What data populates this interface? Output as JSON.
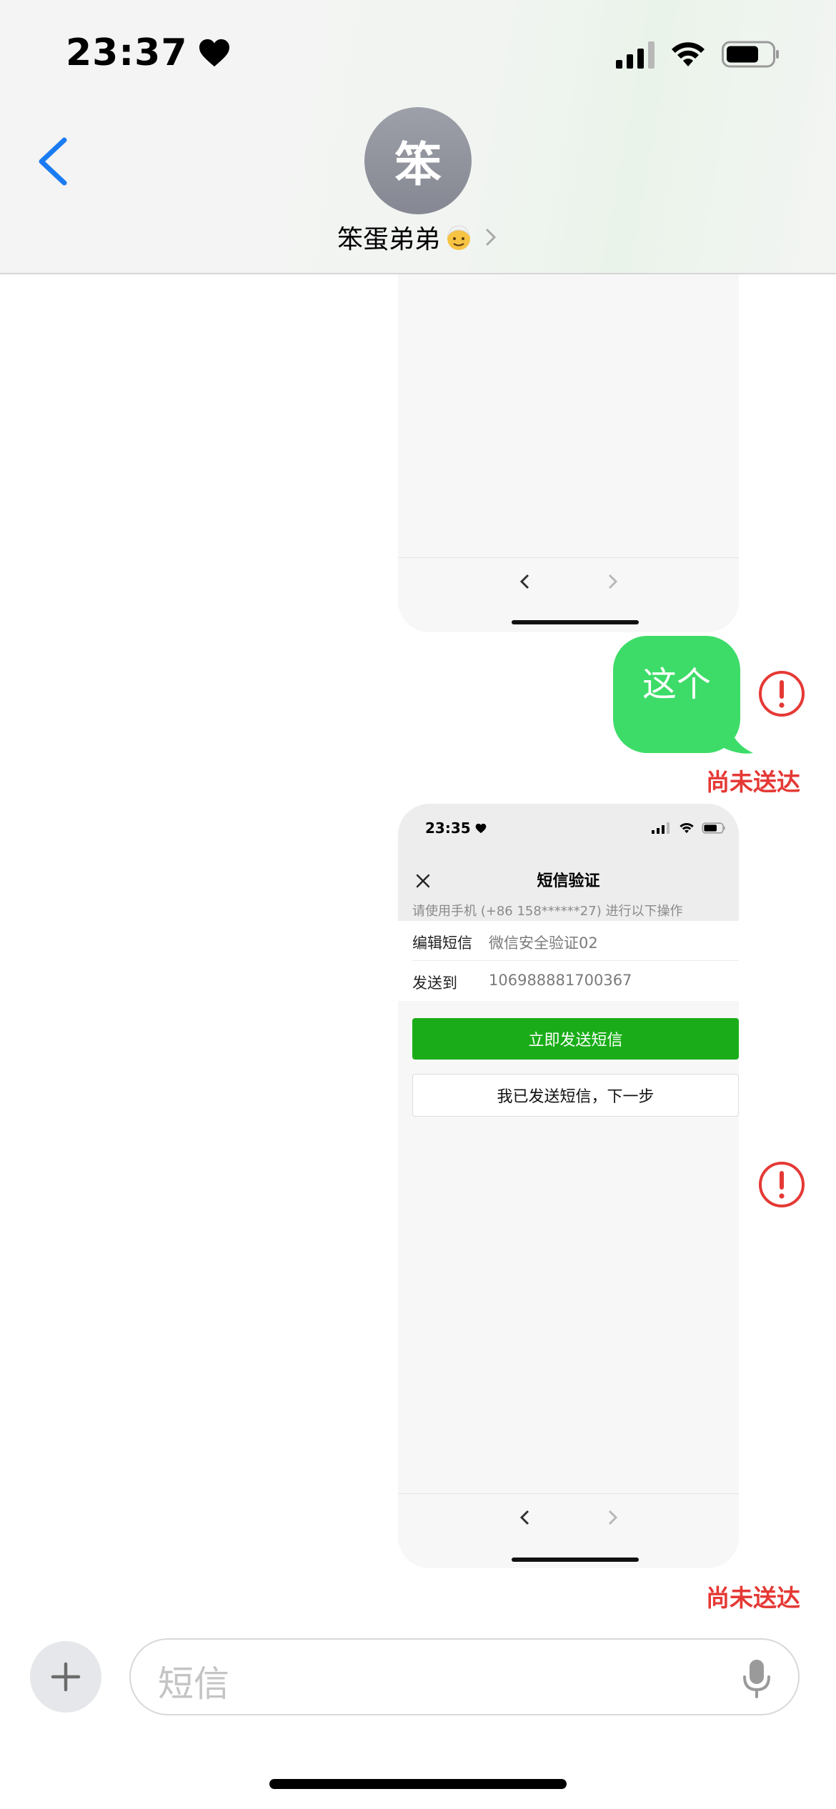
{
  "status_bar": {
    "time": "23:37"
  },
  "header": {
    "avatar_initial": "笨",
    "contact_name": "笨蛋弟弟"
  },
  "messages": [
    {
      "type": "text",
      "text": "这个",
      "status": "尚未送达"
    },
    {
      "type": "screenshot",
      "status": "尚未送达"
    }
  ],
  "embedded_screenshot": {
    "time": "23:35",
    "title": "短信验证",
    "hint": "请使用手机 (+86 158******27) 进行以下操作",
    "rows": [
      {
        "label": "编辑短信",
        "value": "微信安全验证02"
      },
      {
        "label": "发送到",
        "value": "106988881700367"
      }
    ],
    "primary_button": "立即发送短信",
    "secondary_button": "我已发送短信，下一步"
  },
  "composer": {
    "placeholder": "短信"
  },
  "colors": {
    "bubble_green": "#3ddc68",
    "error_red": "#e53935",
    "ios_blue": "#1a7cf2",
    "wechat_green": "#1aad19"
  },
  "icons": [
    "heart-icon",
    "cellular-signal-icon",
    "wifi-icon",
    "battery-icon",
    "back-chevron-icon",
    "chevron-right-icon",
    "error-icon",
    "plus-icon",
    "microphone-icon",
    "close-icon"
  ]
}
